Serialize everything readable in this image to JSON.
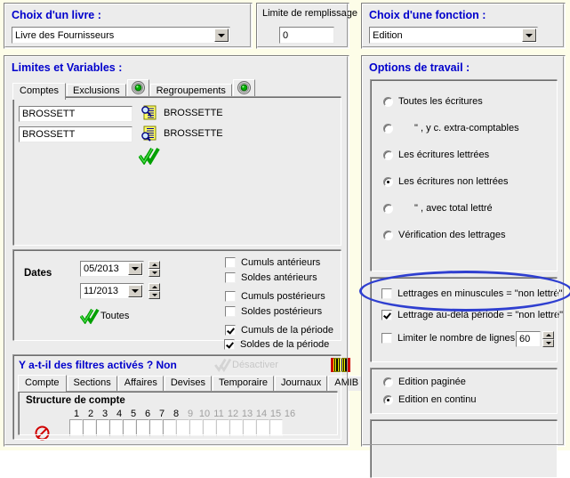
{
  "book_panel": {
    "legend": "Choix d'un livre :",
    "combo_value": "Livre des Fournisseurs"
  },
  "fill_limit_panel": {
    "label": "Limite de remplissage",
    "value": "0"
  },
  "function_panel": {
    "legend": "Choix d'une fonction :",
    "combo_value": "Edition"
  },
  "limits_panel": {
    "legend": "Limites et Variables :",
    "tabs": [
      {
        "label": "Comptes",
        "selected": true
      },
      {
        "label": "Exclusions",
        "selected": false
      },
      {
        "label": "Regroupements",
        "selected": false
      }
    ],
    "accounts": [
      {
        "value": "BROSSETT",
        "resolved": "BROSSETTE"
      },
      {
        "value": "BROSSETT",
        "resolved": "BROSSETTE"
      }
    ],
    "dates": {
      "label": "Dates",
      "from": "05/2013",
      "to": "11/2013",
      "all_label": "Toutes"
    },
    "checkboxes": [
      {
        "label": "Cumuls antérieurs",
        "checked": false
      },
      {
        "label": "Soldes antérieurs",
        "checked": false
      },
      {
        "label": "Cumuls postérieurs",
        "checked": false
      },
      {
        "label": "Soldes postérieurs",
        "checked": false
      },
      {
        "label": "Cumuls de la période",
        "checked": true
      },
      {
        "label": "Soldes de la période",
        "checked": true
      }
    ]
  },
  "filters_panel": {
    "question": "Y a-t-il des filtres activés ? Non",
    "disable_label": "Désactiver",
    "tabs": [
      {
        "label": "Compte",
        "selected": true
      },
      {
        "label": "Sections",
        "selected": false
      },
      {
        "label": "Affaires",
        "selected": false
      },
      {
        "label": "Devises",
        "selected": false
      },
      {
        "label": "Temporaire",
        "selected": false
      },
      {
        "label": "Journaux",
        "selected": false
      },
      {
        "label": "AMIB",
        "selected": false
      }
    ],
    "structure_title": "Structure de compte",
    "structure_numbers": [
      "1",
      "2",
      "3",
      "4",
      "5",
      "6",
      "7",
      "8",
      "9",
      "10",
      "11",
      "12",
      "13",
      "14",
      "15",
      "16"
    ],
    "structure_active_count": 8,
    "structure_values": [
      "",
      "",
      "",
      "",
      "",
      "",
      "",
      "",
      "",
      "",
      "",
      "",
      "",
      "",
      "",
      ""
    ]
  },
  "options_panel": {
    "legend": "Options de travail :",
    "entry_radios": [
      {
        "label": "Toutes les écritures",
        "selected": false,
        "indent": false
      },
      {
        "label": "\"      , y c. extra-comptables",
        "selected": false,
        "indent": true
      },
      {
        "label": "Les écritures lettrées",
        "selected": false,
        "indent": false
      },
      {
        "label": "Les écritures non lettrées",
        "selected": true,
        "indent": false
      },
      {
        "label": "\"      , avec total lettré",
        "selected": false,
        "indent": true
      },
      {
        "label": "Vérification des lettrages",
        "selected": false,
        "indent": false
      }
    ],
    "lettering_checks": [
      {
        "label": "Lettrages en minuscules = \"non lettré\"",
        "checked": false
      },
      {
        "label": "Lettrage au-delà période = \"non lettré\"",
        "checked": true
      }
    ],
    "limit_lines": {
      "label": "Limiter le nombre de lignes à :",
      "checked": false,
      "value": "60"
    },
    "edition_radios": [
      {
        "label": "Edition paginée",
        "selected": false
      },
      {
        "label": "Edition en continu",
        "selected": true
      }
    ]
  },
  "colors": {
    "legend_blue": "#0000cc",
    "annotation_blue": "#2f3fd0",
    "page_background": "#fdfde8",
    "panel_face": "#ececec",
    "icon_green": "#00a000",
    "icon_yellow": "#ffff00",
    "icon_red": "#cc0000"
  }
}
